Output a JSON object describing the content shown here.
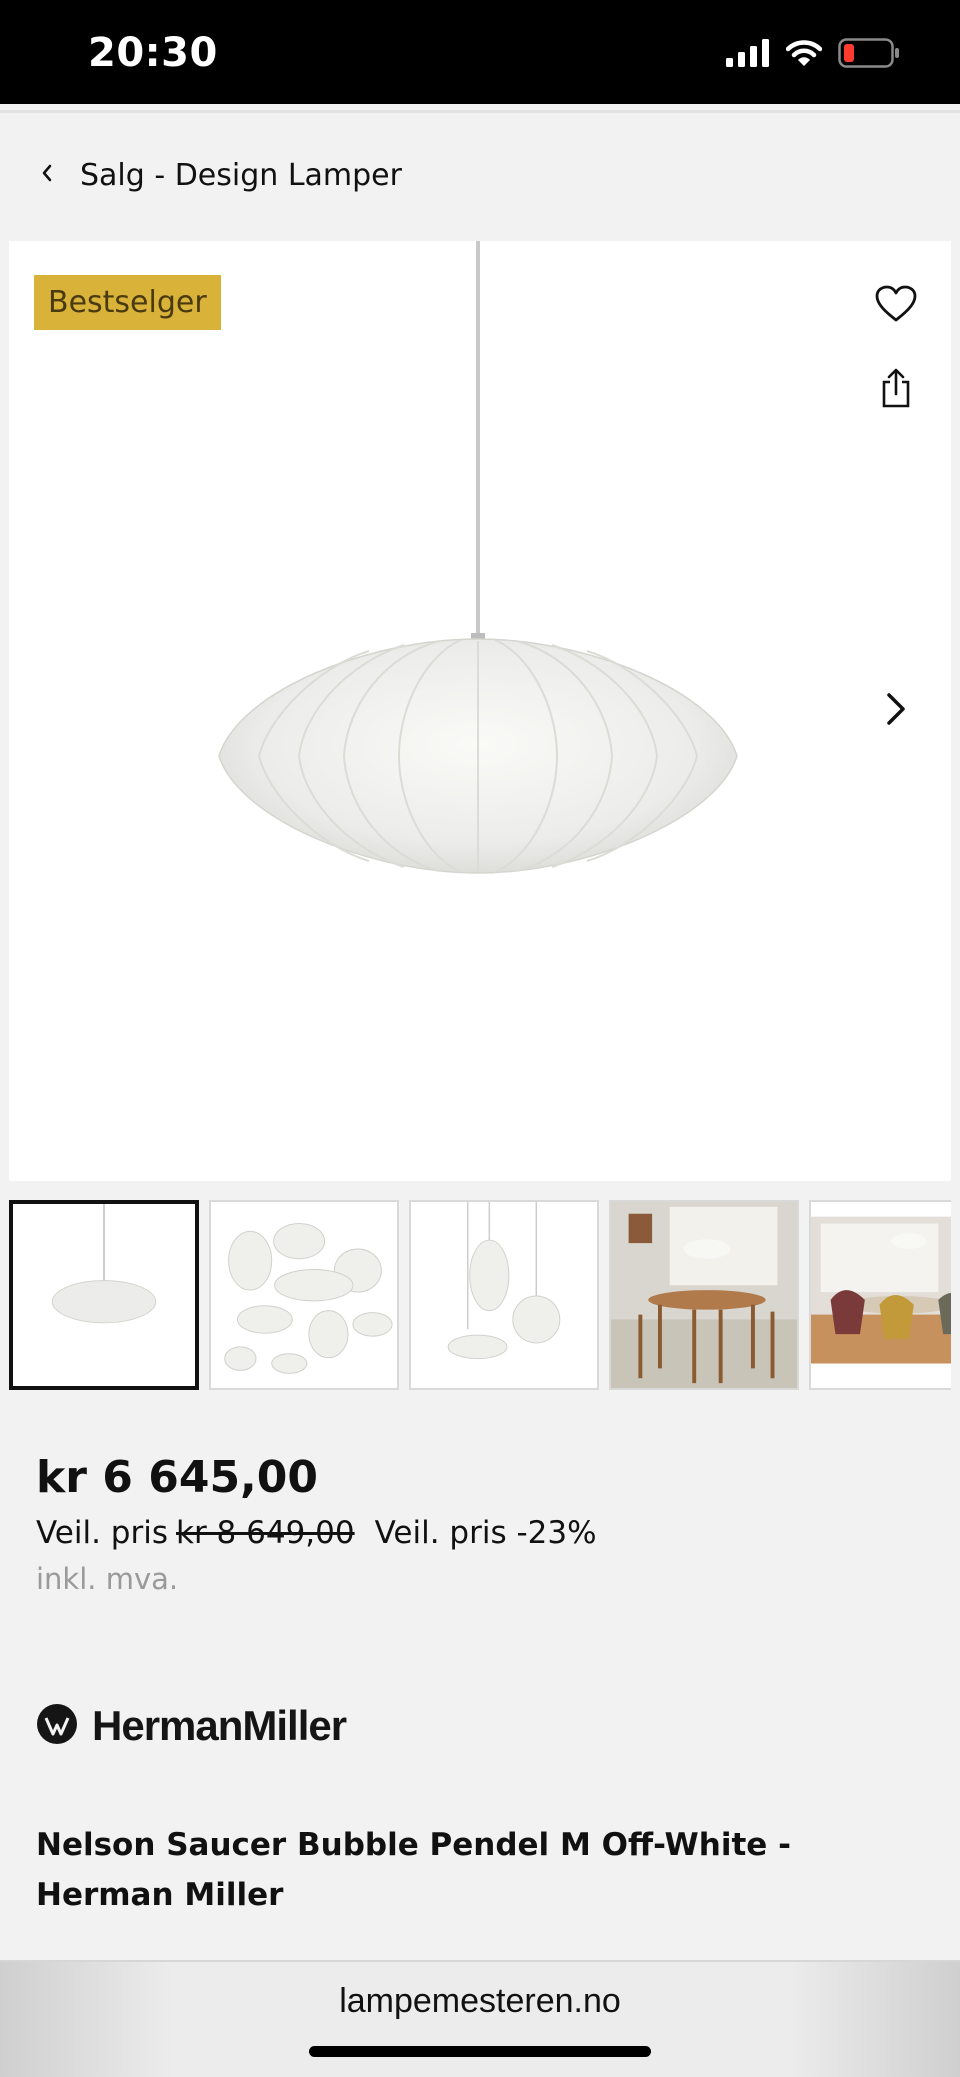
{
  "status_bar": {
    "time": "20:30"
  },
  "breadcrumb": {
    "label": "Salg - Design Lamper"
  },
  "gallery": {
    "badge": "Bestselger"
  },
  "pricing": {
    "price": "kr 6 645,00",
    "rec_label": "Veil. pris",
    "old_price": "kr 8 649,00",
    "discount": "Veil. pris -23%",
    "vat": "inkl. mva."
  },
  "brand": {
    "name": "HermanMiller"
  },
  "product": {
    "title": "Nelson Saucer Bubble Pendel M Off-White - Herman Miller"
  },
  "browser": {
    "url": "lampemesteren.no"
  },
  "colors": {
    "badge_bg": "#d9b23a",
    "status_bar_bg": "#000000",
    "page_bg": "#f2f2f2"
  },
  "icons": [
    "signal-icon",
    "wifi-icon",
    "battery-icon",
    "back-chevron-icon",
    "heart-icon",
    "share-icon",
    "next-chevron-icon",
    "brand-logo-icon"
  ]
}
